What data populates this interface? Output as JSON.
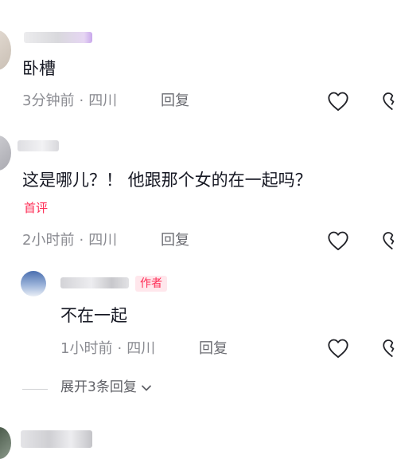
{
  "comments": [
    {
      "text": "卧槽",
      "time": "3分钟前",
      "separator": "·",
      "location": "四川",
      "reply_label": "回复"
    },
    {
      "text": "这是哪儿？！ 他跟那个女的在一起吗？",
      "badge": "首评",
      "time": "2小时前",
      "separator": "·",
      "location": "四川",
      "reply_label": "回复",
      "replies": [
        {
          "author_tag": "作者",
          "text": "不在一起",
          "time": "1小时前",
          "separator": "·",
          "location": "四川",
          "reply_label": "回复"
        }
      ],
      "expand_label": "展开3条回复"
    }
  ],
  "icons": {
    "like": "heart-outline-icon",
    "dislike": "broken-heart-icon",
    "expand": "chevron-down-icon"
  },
  "colors": {
    "accent": "#fe2c55",
    "meta_text": "#8a8b91"
  }
}
